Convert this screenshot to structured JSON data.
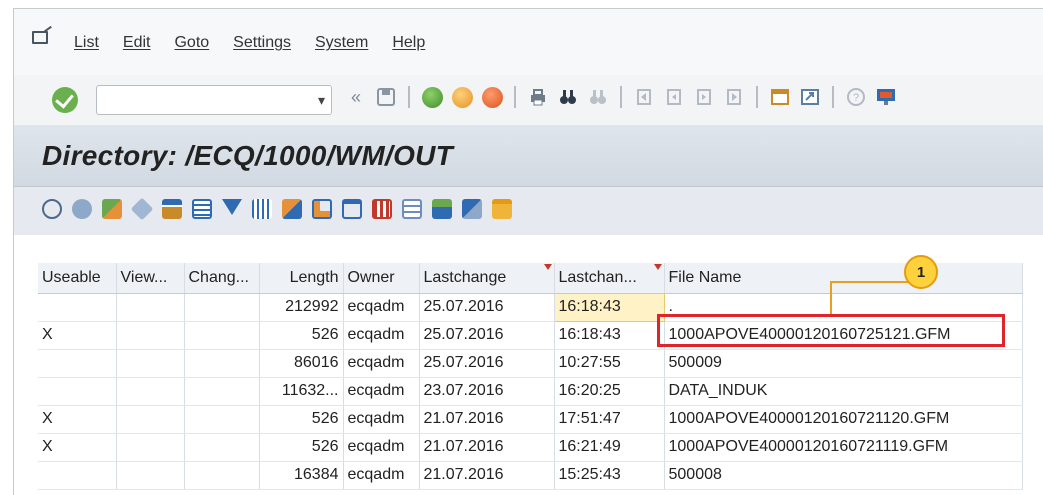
{
  "menu": {
    "items": [
      "List",
      "Edit",
      "Goto",
      "Settings",
      "System",
      "Help"
    ]
  },
  "toolbar": {
    "command_value": "",
    "back_label": "«"
  },
  "title": "Directory: /ECQ/1000/WM/OUT",
  "table": {
    "headers": [
      "Useable",
      "View...",
      "Chang...",
      "Length",
      "Owner",
      "Lastchange",
      "Lastchan...",
      "File Name"
    ],
    "rows": [
      [
        "",
        "",
        "",
        "212992",
        "ecqadm",
        "25.07.2016",
        "16:18:43",
        "."
      ],
      [
        "X",
        "",
        "",
        "526",
        "ecqadm",
        "25.07.2016",
        "16:18:43",
        "1000APOVE40000120160725121.GFM"
      ],
      [
        "",
        "",
        "",
        "86016",
        "ecqadm",
        "25.07.2016",
        "10:27:55",
        "500009"
      ],
      [
        "",
        "",
        "",
        "11632...",
        "ecqadm",
        "23.07.2016",
        "16:20:25",
        "DATA_INDUK"
      ],
      [
        "X",
        "",
        "",
        "526",
        "ecqadm",
        "21.07.2016",
        "17:51:47",
        "1000APOVE40000120160721120.GFM"
      ],
      [
        "X",
        "",
        "",
        "526",
        "ecqadm",
        "21.07.2016",
        "16:21:49",
        "1000APOVE40000120160721119.GFM"
      ],
      [
        "",
        "",
        "",
        "16384",
        "ecqadm",
        "21.07.2016",
        "15:25:43",
        "500008"
      ]
    ]
  },
  "annotation": {
    "badge": "1",
    "highlight_color": "#e0242b",
    "line_color": "#e6a020"
  },
  "icons": {
    "app_toolbar": [
      "refresh-icon",
      "display-icon",
      "copy-icon",
      "filter-icon",
      "sort-ascending-icon",
      "sort-descending-icon",
      "filter-set-icon",
      "total-icon",
      "subtotal-icon",
      "print-preview-icon",
      "export-icon",
      "layout-icon",
      "change-layout-icon",
      "save-layout-icon",
      "info-icon",
      "folder-icon"
    ]
  }
}
